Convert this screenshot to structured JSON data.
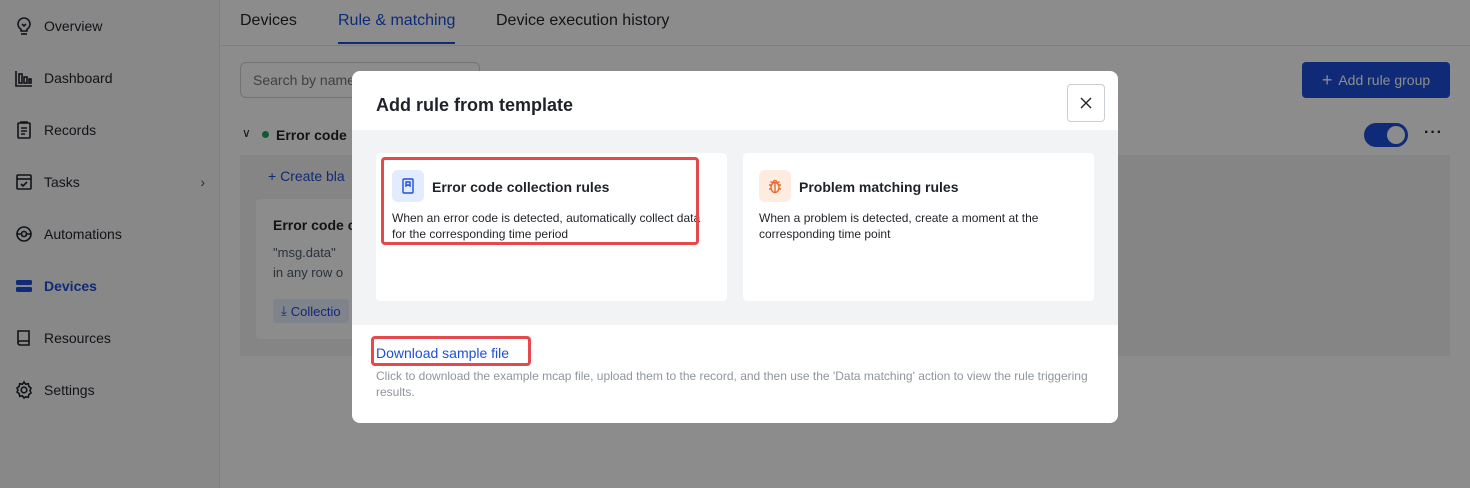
{
  "sidebar": {
    "items": [
      {
        "label": "Overview",
        "icon": "overview-icon"
      },
      {
        "label": "Dashboard",
        "icon": "dashboard-icon"
      },
      {
        "label": "Records",
        "icon": "records-icon"
      },
      {
        "label": "Tasks",
        "icon": "tasks-icon",
        "has_submenu": true
      },
      {
        "label": "Automations",
        "icon": "automations-icon"
      },
      {
        "label": "Devices",
        "icon": "devices-icon",
        "active": true
      },
      {
        "label": "Resources",
        "icon": "resources-icon"
      },
      {
        "label": "Settings",
        "icon": "settings-icon"
      }
    ]
  },
  "tabs": [
    {
      "label": "Devices"
    },
    {
      "label": "Rule & matching",
      "active": true
    },
    {
      "label": "Device execution history"
    }
  ],
  "search": {
    "placeholder": "Search by name"
  },
  "add_group_label": "Add rule group",
  "group": {
    "title": "Error code",
    "enabled": true,
    "create_blank": "Create bla",
    "rule": {
      "title": "Error code c",
      "desc_line1": "\"msg.data\"",
      "desc_line2": "in any row o",
      "action": "Collectio"
    }
  },
  "modal": {
    "title": "Add rule from template",
    "templates": [
      {
        "title": "Error code collection rules",
        "desc": "When an error code is detected, automatically collect data for the corresponding time period",
        "icon": "document-icon",
        "highlighted": true
      },
      {
        "title": "Problem matching rules",
        "desc": "When a problem is detected, create a moment at the corresponding time point",
        "icon": "bug-icon",
        "highlighted": false
      }
    ],
    "download_link": "Download sample file",
    "download_desc": "Click to download the example mcap file, upload them to the record, and then use the 'Data matching' action to view the rule triggering results."
  },
  "colors": {
    "accent": "#1d4ed8",
    "highlight": "#e5484d",
    "enabled_dot": "#22a559"
  }
}
